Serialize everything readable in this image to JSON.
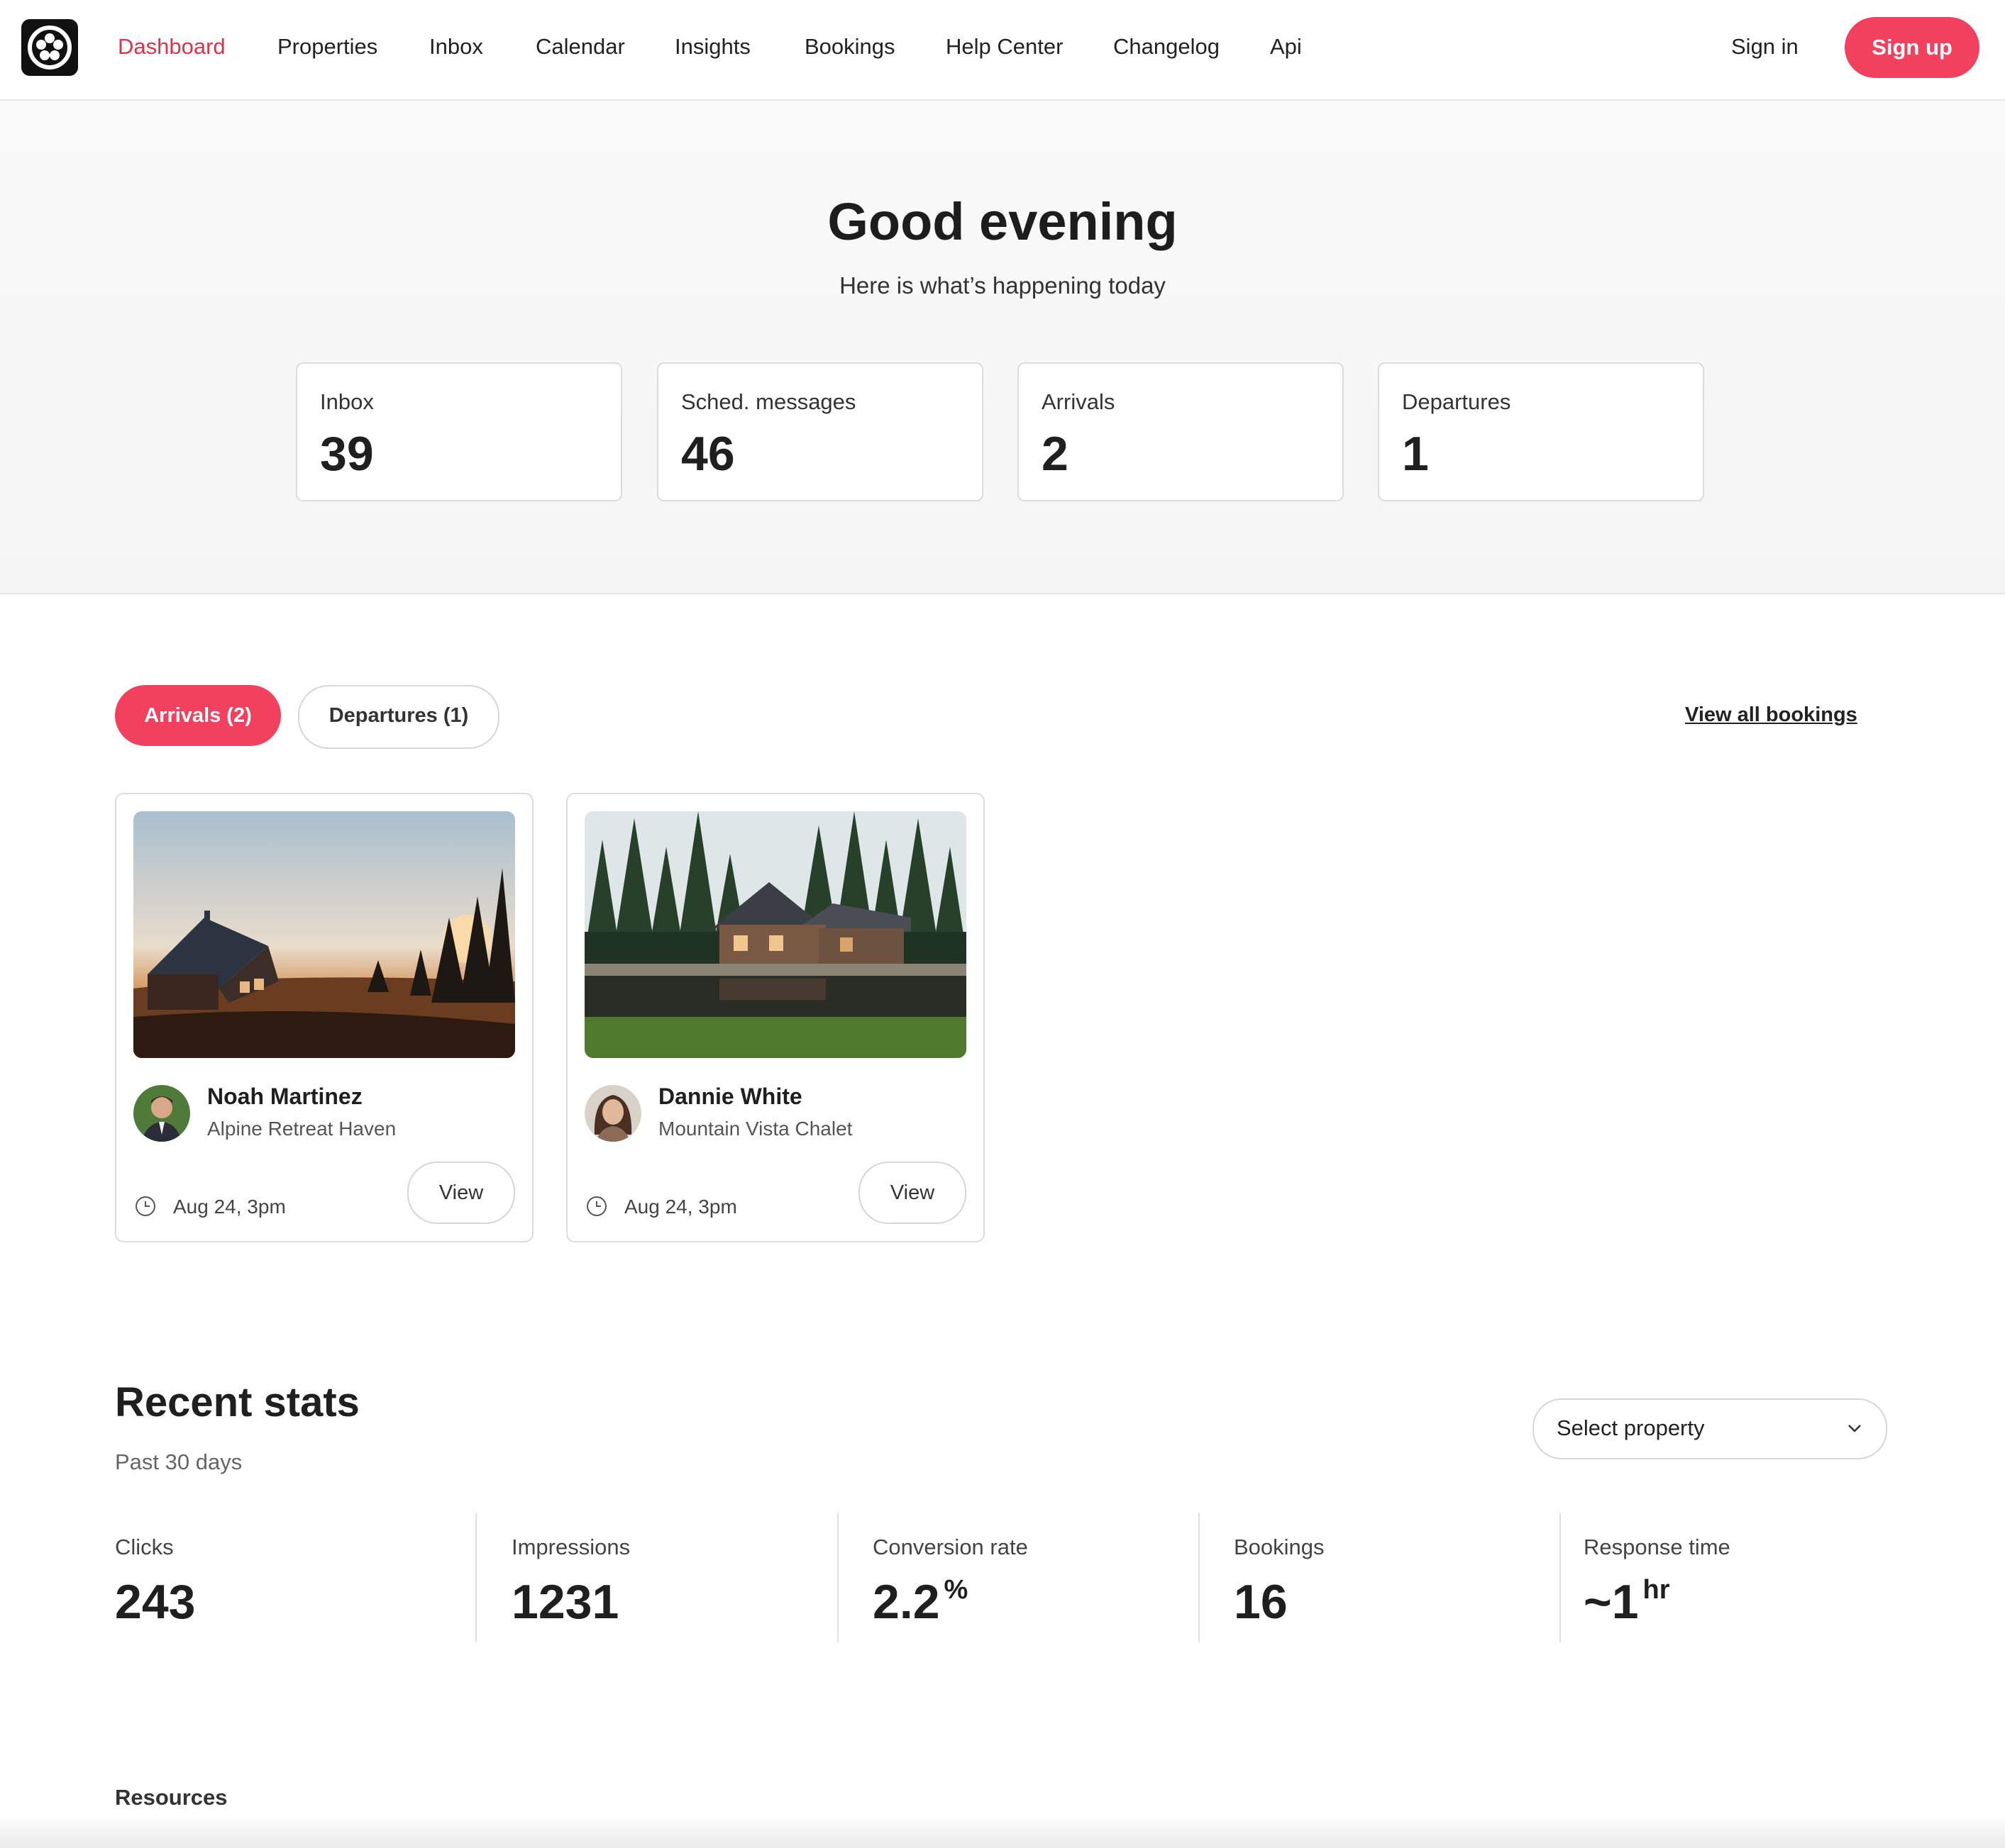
{
  "nav": {
    "items": [
      {
        "label": "Dashboard",
        "active": true
      },
      {
        "label": "Properties",
        "active": false
      },
      {
        "label": "Inbox",
        "active": false
      },
      {
        "label": "Calendar",
        "active": false
      },
      {
        "label": "Insights",
        "active": false
      },
      {
        "label": "Bookings",
        "active": false
      },
      {
        "label": "Help Center",
        "active": false
      },
      {
        "label": "Changelog",
        "active": false
      },
      {
        "label": "Api",
        "active": false
      }
    ],
    "sign_in": "Sign in",
    "sign_up": "Sign up"
  },
  "hero": {
    "title": "Good evening",
    "subtitle": "Here is what’s happening today",
    "stats": [
      {
        "label": "Inbox",
        "value": "39"
      },
      {
        "label": "Sched. messages",
        "value": "46"
      },
      {
        "label": "Arrivals",
        "value": "2"
      },
      {
        "label": "Departures",
        "value": "1"
      }
    ]
  },
  "bookings": {
    "tabs": [
      {
        "label": "Arrivals (2)",
        "active": true
      },
      {
        "label": "Departures (1)",
        "active": false
      }
    ],
    "view_all": "View all bookings",
    "cards": [
      {
        "guest": "Noah Martinez",
        "property": "Alpine Retreat Haven",
        "date": "Aug 24, 3pm",
        "view": "View"
      },
      {
        "guest": "Dannie White",
        "property": "Mountain Vista Chalet",
        "date": "Aug 24, 3pm",
        "view": "View"
      }
    ]
  },
  "recent_stats": {
    "title": "Recent stats",
    "subtitle": "Past 30 days",
    "select_placeholder": "Select property",
    "metrics": [
      {
        "label": "Clicks",
        "value": "243",
        "unit": ""
      },
      {
        "label": "Impressions",
        "value": "1231",
        "unit": ""
      },
      {
        "label": "Conversion rate",
        "value": "2.2",
        "unit": "%"
      },
      {
        "label": "Bookings",
        "value": "16",
        "unit": ""
      },
      {
        "label": "Response time",
        "value": "~1",
        "unit": "hr"
      }
    ]
  },
  "resources": {
    "title": "Resources"
  },
  "colors": {
    "accent": "#f2405f",
    "active_link": "#e0314c",
    "text": "#222222"
  },
  "icons": {
    "logo": "flower-logo-icon",
    "clock": "clock-icon",
    "chevron": "chevron-down-icon"
  }
}
